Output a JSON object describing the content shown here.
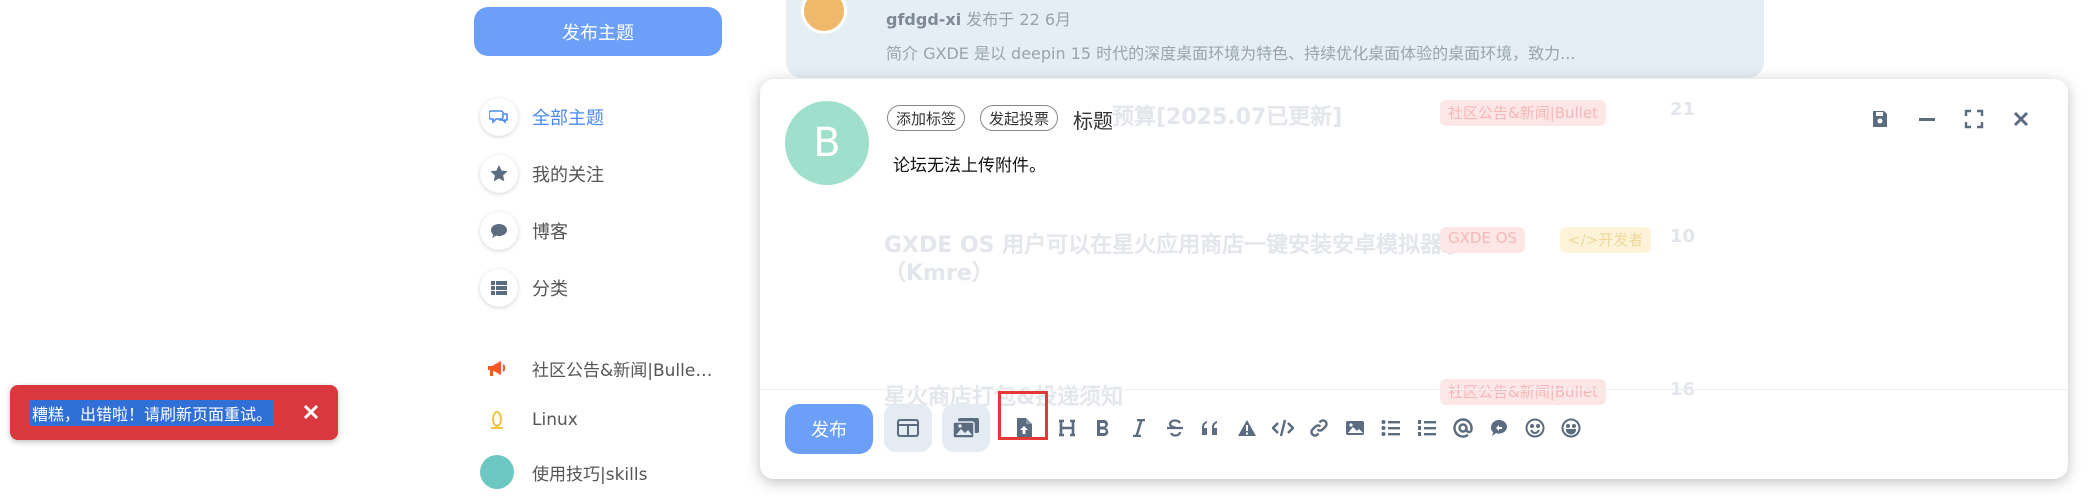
{
  "sidebar": {
    "new_topic": "发布主题",
    "nav": [
      {
        "label": "全部主题",
        "icon": "comments-icon"
      },
      {
        "label": "我的关注",
        "icon": "star-icon"
      },
      {
        "label": "博客",
        "icon": "comment-icon"
      },
      {
        "label": "分类",
        "icon": "list-icon"
      }
    ],
    "categories": [
      {
        "label": "社区公告&新闻|Bulle…",
        "icon": "megaphone-icon",
        "color": "#f15a24"
      },
      {
        "label": "Linux",
        "icon": "linux-icon",
        "color": "#f6c343"
      },
      {
        "label": "使用技巧|skills",
        "icon": "skills-icon",
        "color": "#6cc7c2"
      }
    ]
  },
  "background": {
    "author": "gfdgd-xi",
    "meta_suffix": " 发布于 22 6月",
    "excerpt": "简介 GXDE 是以 deepin 15 时代的深度桌面环境为特色、持续优化桌面体验的桌面环境，致力...",
    "list": [
      {
        "title": "…预算[2025.07已更新]",
        "tag": "社区公告&新闻|Bullet",
        "count": "21"
      },
      {
        "title": "GXDE OS 用户可以在星火应用商店一键安装安卓模拟器了",
        "title2": "（Kmre）",
        "tag": "GXDE OS",
        "tag2": "</>开发者",
        "count": "10"
      },
      {
        "title": "星火商店打包&投递须知",
        "tag": "社区公告&新闻|Bullet",
        "count": "16"
      }
    ]
  },
  "composer": {
    "avatar_letter": "B",
    "chip_tags": "添加标签",
    "chip_poll": "发起投票",
    "title_placeholder": "标题",
    "body": "论坛无法上传附件。",
    "publish": "发布"
  },
  "toast": {
    "message": "糟糕，出错啦！请刷新页面重试。"
  },
  "colors": {
    "accent": "#6c9ff7",
    "error": "#d9383c",
    "highlight": "#e53935"
  }
}
